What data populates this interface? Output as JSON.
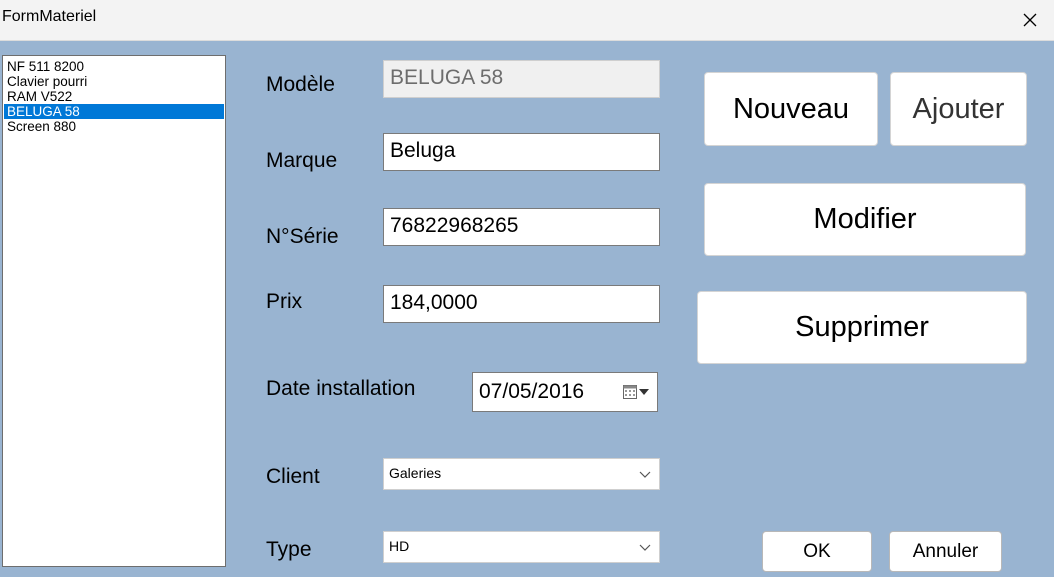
{
  "window": {
    "title": "FormMateriel"
  },
  "list": {
    "items": [
      "NF 511 8200",
      "Clavier pourri",
      "RAM V522",
      "BELUGA 58",
      "Screen 880"
    ],
    "selected_index": 3
  },
  "form": {
    "modele": {
      "label": "Modèle",
      "value": "BELUGA 58"
    },
    "marque": {
      "label": "Marque",
      "value": "Beluga"
    },
    "serie": {
      "label": "N°Série",
      "value": "76822968265"
    },
    "prix": {
      "label": "Prix",
      "value": "184,0000"
    },
    "date": {
      "label": "Date installation",
      "value": "07/05/2016"
    },
    "client": {
      "label": "Client",
      "value": "Galeries"
    },
    "type": {
      "label": "Type",
      "value": "HD"
    }
  },
  "buttons": {
    "nouveau": "Nouveau",
    "ajouter": "Ajouter",
    "modifier": "Modifier",
    "supprimer": "Supprimer",
    "ok": "OK",
    "annuler": "Annuler"
  },
  "icons": {
    "close": "close-icon",
    "calendar": "calendar-icon",
    "dropdown": "chevron-down-icon"
  },
  "colors": {
    "form_background": "#99b4d1",
    "selection": "#0078d7"
  }
}
